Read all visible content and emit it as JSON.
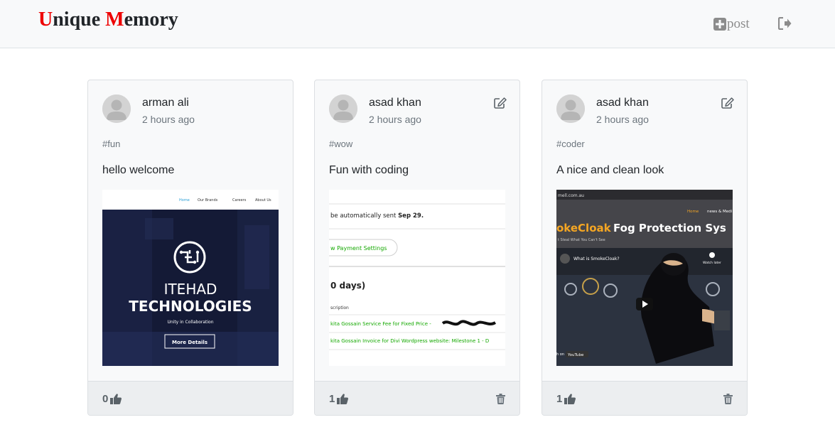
{
  "brand": {
    "first_initial": "U",
    "first_rest": "nique ",
    "second_initial": "M",
    "second_rest": "emory",
    "accent_color": "#ee0000"
  },
  "nav": {
    "post_label": "post",
    "post_icon": "plus-square-icon",
    "logout_icon": "sign-out-icon"
  },
  "posts": [
    {
      "author": "arman ali",
      "time": "2 hours ago",
      "tag": "#fun",
      "text": "hello welcome",
      "likes": "0",
      "editable": false,
      "image": {
        "menu_home": "Home",
        "menu_brands": "Our Brands",
        "menu_careers": "Careers",
        "menu_about": "About Us",
        "title_line1": "ITEHAD",
        "title_line2": "TECHNOLOGIES",
        "tagline": "Unity in Collaboration",
        "button": "More Details"
      }
    },
    {
      "author": "asad khan",
      "time": "2 hours ago",
      "tag": "#wow",
      "text": "Fun with coding",
      "likes": "1",
      "editable": true,
      "image": {
        "line1": "be automatically sent",
        "line1_bold": "Sep 29.",
        "button": "w Payment Settings",
        "heading": "0 days)",
        "col": "scription",
        "row1": "kita Gossain Service Fee for Fixed Price -",
        "row2": "kita Gossain Invoice for Divi Wordpress website: Milestone 1 - D"
      }
    },
    {
      "author": "asad khan",
      "time": "2 hours ago",
      "tag": "#coder",
      "text": "A nice and clean look",
      "likes": "1",
      "editable": true,
      "image": {
        "url_text": "mell.com.au",
        "menu_home": "Home",
        "menu_news": "news & Medi",
        "headline_orange": "okeCloak",
        "headline_white": " Fog Protection Sys",
        "subhead": "t Steal What You Can't See",
        "video_title": "What is SmokeCloak?",
        "watch_later": "Watch later",
        "yt_prefix": "h on",
        "yt": "YouTube"
      }
    }
  ]
}
